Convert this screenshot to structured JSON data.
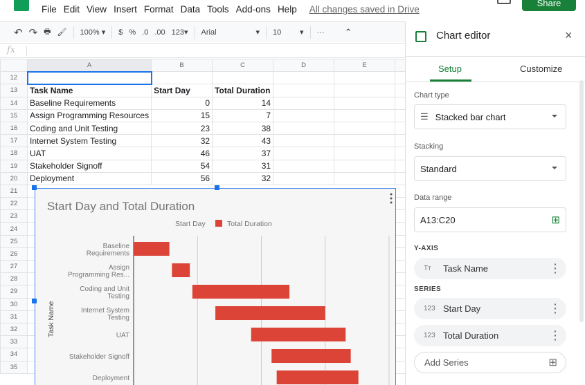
{
  "menu": {
    "items": [
      "File",
      "Edit",
      "View",
      "Insert",
      "Format",
      "Data",
      "Tools",
      "Add-ons",
      "Help"
    ],
    "saved_status": "All changes saved in Drive",
    "share_label": "Share"
  },
  "toolbar": {
    "zoom": "100%",
    "currency": "$",
    "percent": "%",
    "dec_decrease": ".0",
    "dec_increase": ".00",
    "format": "123",
    "font": "Arial",
    "font_size": "10",
    "more": "···"
  },
  "formula_bar": {
    "fx": "fx",
    "value": ""
  },
  "sheet": {
    "columns": [
      "A",
      "B",
      "C",
      "D",
      "E"
    ],
    "rows": [
      {
        "n": "12",
        "cells": [
          "",
          "",
          ""
        ]
      },
      {
        "n": "13",
        "cells": [
          "Task Name",
          "Start Day",
          "Total Duration"
        ]
      },
      {
        "n": "14",
        "cells": [
          "Baseline Requirements",
          "0",
          "14"
        ]
      },
      {
        "n": "15",
        "cells": [
          "Assign Programming Resources",
          "15",
          "7"
        ]
      },
      {
        "n": "16",
        "cells": [
          "Coding and Unit Testing",
          "23",
          "38"
        ]
      },
      {
        "n": "17",
        "cells": [
          "Internet System Testing",
          "32",
          "43"
        ]
      },
      {
        "n": "18",
        "cells": [
          "UAT",
          "46",
          "37"
        ]
      },
      {
        "n": "19",
        "cells": [
          "Stakeholder Signoff",
          "54",
          "31"
        ]
      },
      {
        "n": "20",
        "cells": [
          "Deployment",
          "56",
          "32"
        ]
      }
    ],
    "chart_rows": [
      "21",
      "22",
      "23",
      "24",
      "25",
      "26",
      "27",
      "28",
      "29",
      "30",
      "31",
      "32",
      "33",
      "34",
      "35"
    ]
  },
  "chart_data": {
    "type": "bar",
    "orientation": "horizontal",
    "stacked": true,
    "title": "Start Day and Total Duration",
    "ylabel": "Task Name",
    "xlabel": "",
    "categories": [
      "Baseline Requirements",
      "Assign Programming Resources",
      "Coding and Unit Testing",
      "Internet System Testing",
      "UAT",
      "Stakeholder Signoff",
      "Deployment"
    ],
    "category_labels": [
      [
        "Baseline",
        "Requirements"
      ],
      [
        "Assign",
        "Programming Res..."
      ],
      [
        "Coding and Unit",
        "Testing"
      ],
      [
        "Internet System",
        "Testing"
      ],
      [
        "UAT"
      ],
      [
        "Stakeholder Signoff"
      ],
      [
        "Deployment"
      ]
    ],
    "series": [
      {
        "name": "Start Day",
        "values": [
          0,
          15,
          23,
          32,
          46,
          54,
          56
        ],
        "color": "transparent"
      },
      {
        "name": "Total Duration",
        "values": [
          14,
          7,
          38,
          43,
          37,
          31,
          32
        ],
        "color": "#db4437"
      }
    ],
    "xlim": [
      0,
      100
    ],
    "grid": [
      25,
      50,
      75,
      100
    ],
    "legend": "top"
  },
  "panel": {
    "title": "Chart editor",
    "tabs": [
      "Setup",
      "Customize"
    ],
    "accent": "#188038",
    "chart_type_label": "Chart type",
    "chart_type": "Stacked bar chart",
    "stacking_label": "Stacking",
    "stacking": "Standard",
    "range_label": "Data range",
    "range": "A13:C20",
    "yaxis_label": "Y-AXIS",
    "yaxis": {
      "icon": "Tт",
      "name": "Task Name"
    },
    "series_label": "SERIES",
    "series": [
      {
        "icon": "123",
        "name": "Start Day"
      },
      {
        "icon": "123",
        "name": "Total Duration"
      }
    ],
    "add_series": "Add Series"
  }
}
